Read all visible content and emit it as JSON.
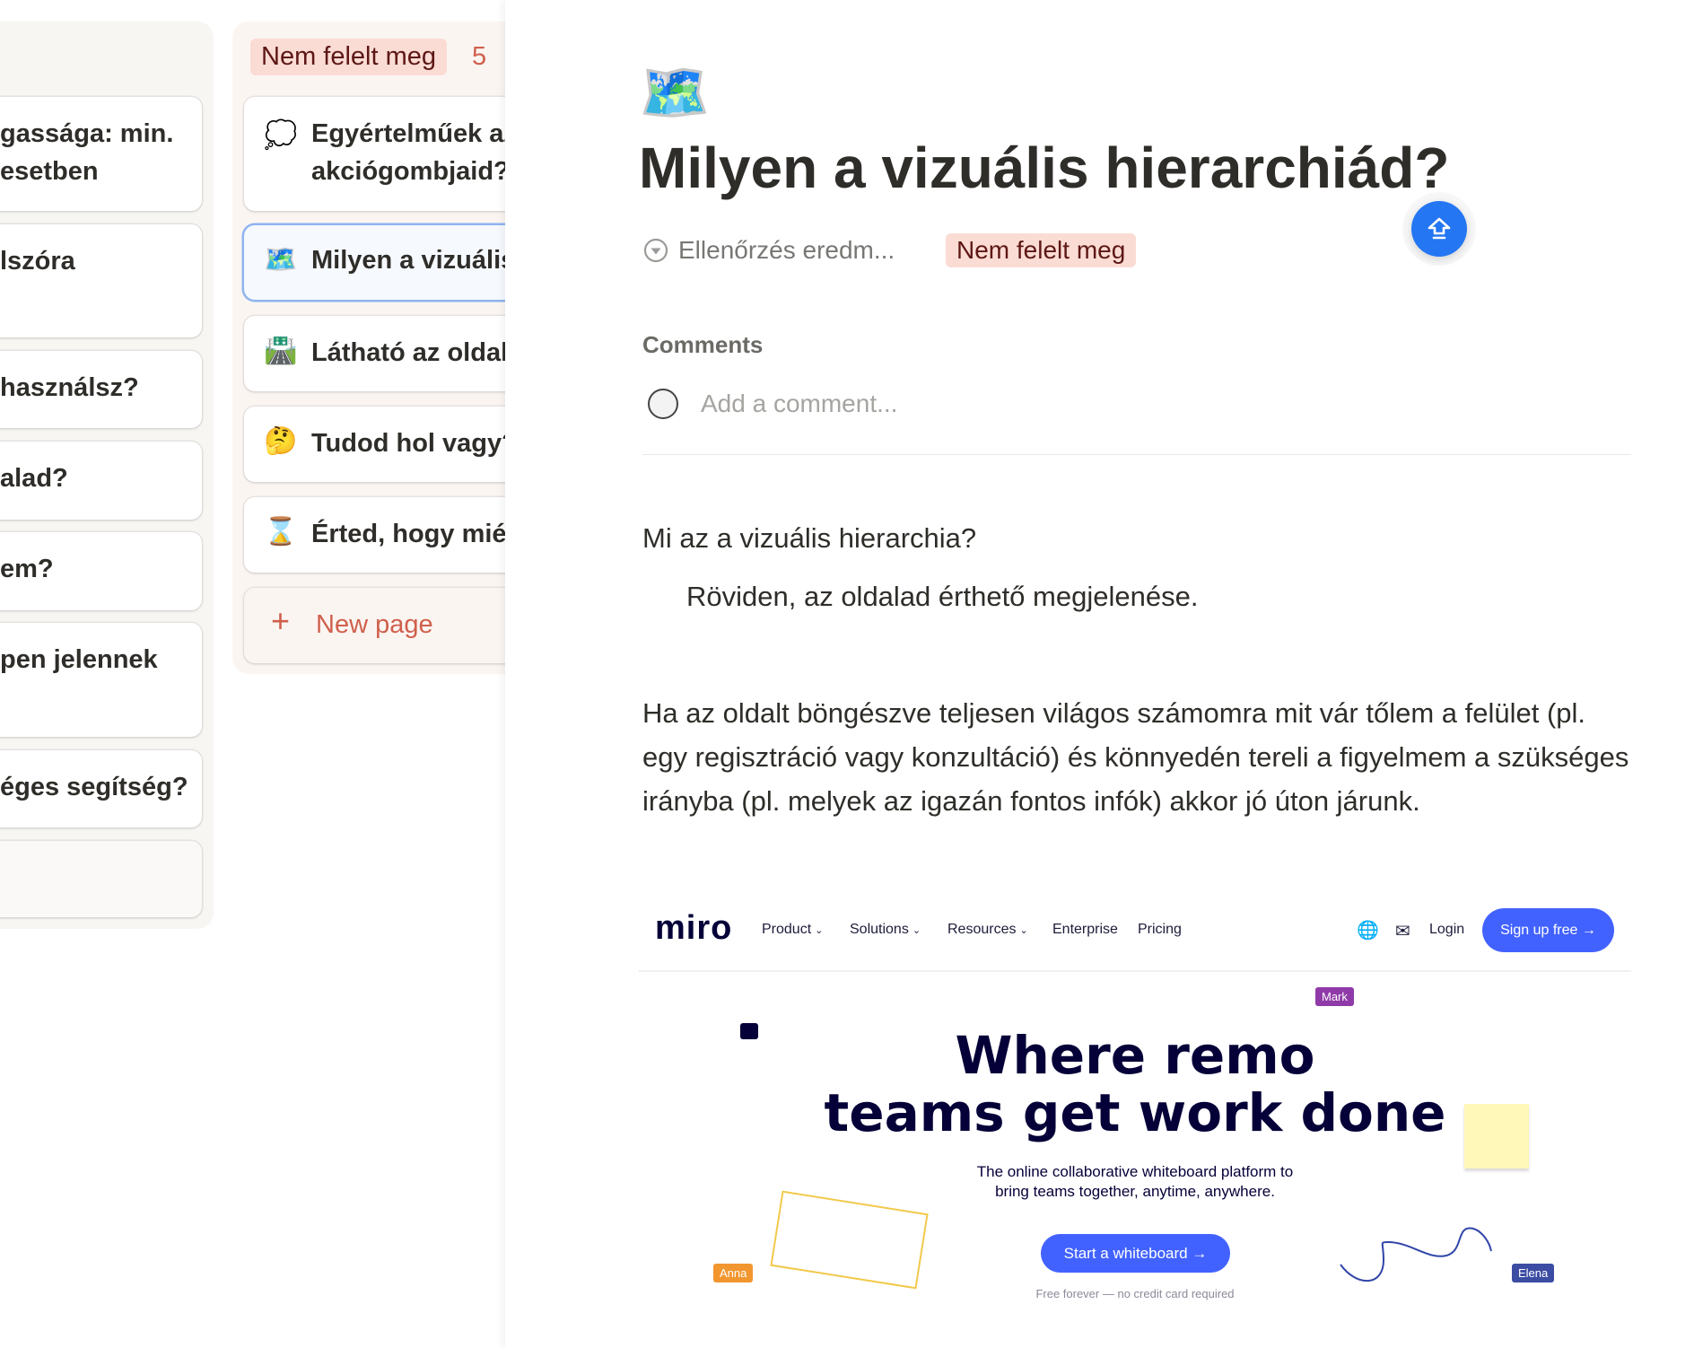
{
  "board": {
    "left_column_cards": [
      "gassága: min.\nesetben",
      "lszóra",
      "használsz?",
      "alad?",
      "em?",
      "pen jelennek",
      "éges segítség?",
      ""
    ],
    "group": {
      "label": "Nem felelt meg",
      "count": "5",
      "badge_bg": "#fadcd4"
    },
    "cards": [
      {
        "icon": "thought-balloon-icon",
        "emoji": "💭",
        "title": "Egyértelműek az\nakciógombjaid?"
      },
      {
        "icon": "world-map-icon",
        "emoji": "🗺️",
        "title": "Milyen a vizuális",
        "selected": true
      },
      {
        "icon": "motorway-icon",
        "emoji": "🛣️",
        "title": "Látható az oldal"
      },
      {
        "icon": "thinking-face-icon",
        "emoji": "🤔",
        "title": "Tudod hol vagy?"
      },
      {
        "icon": "hourglass-icon",
        "emoji": "⌛",
        "title": "Érted, hogy miért"
      }
    ],
    "new_page": "New page"
  },
  "page": {
    "icon": "🗺️",
    "title": "Milyen a vizuális hierarchiád?",
    "property_label": "Ellenőrzés eredm...",
    "property_value": "Nem felelt meg",
    "comments_heading": "Comments",
    "comment_placeholder": "Add a comment...",
    "question": "Mi az a vizuális hierarchia?",
    "answer": "Röviden, az oldalad érthető megjelenése.",
    "paragraph": "Ha az oldalt böngészve teljesen világos számomra mit vár tőlem a felület (pl. egy regisztráció vagy konzultáció) és könnyedén tereli a figyelmem a szükséges irányba (pl. melyek az igazán fontos infók) akkor jó úton járunk."
  },
  "miro": {
    "logo": "miro",
    "nav": [
      "Product",
      "Solutions",
      "Resources",
      "Enterprise",
      "Pricing"
    ],
    "login": "Login",
    "signup": "Sign up free →",
    "headline1": "Where remo",
    "headline2": "teams get work done",
    "sub1": "The online collaborative whiteboard platform to",
    "sub2": "bring teams together, anytime, anywhere.",
    "cta": "Start a whiteboard →",
    "note": "Free forever — no credit card required",
    "cursors": [
      "Mark",
      "Anna",
      "Elena"
    ],
    "accent": "#4262ff"
  }
}
